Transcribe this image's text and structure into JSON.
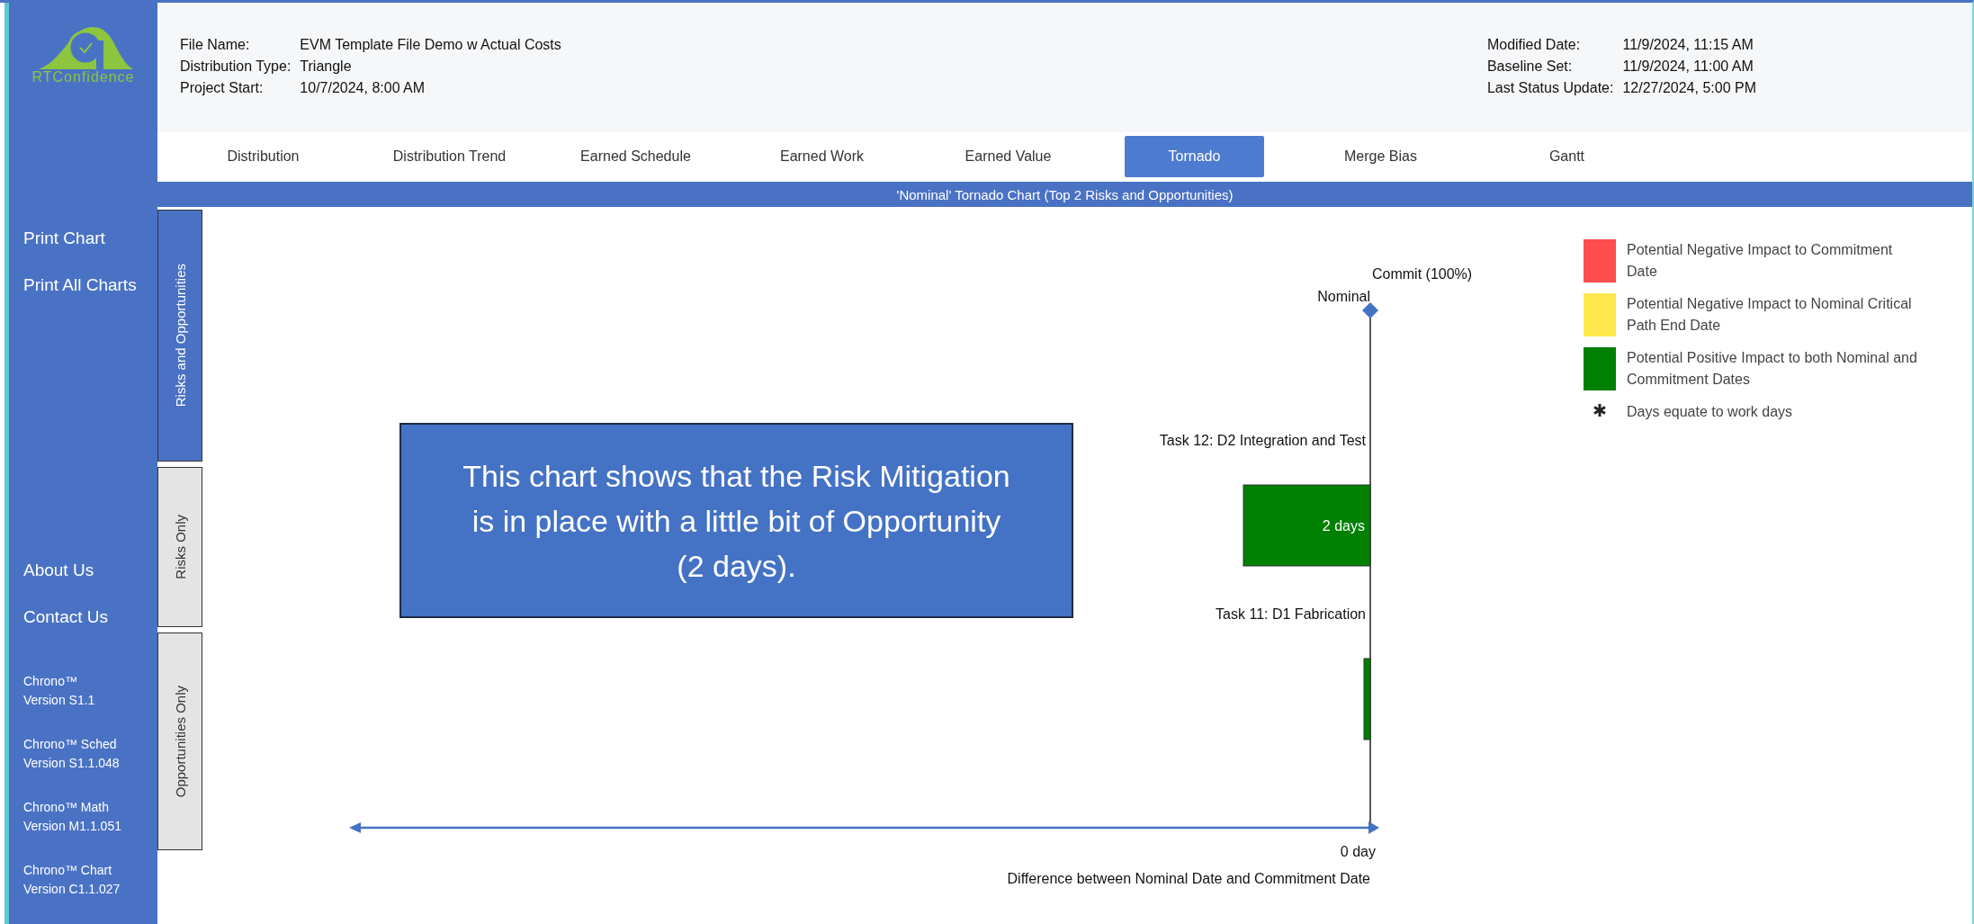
{
  "logo": {
    "text": "RTConfidence"
  },
  "sidebar": {
    "actions": [
      "Print Chart",
      "Print All Charts"
    ],
    "links": [
      "About Us",
      "Contact Us"
    ],
    "versions": [
      {
        "name": "Chrono™",
        "version": "Version S1.1"
      },
      {
        "name": "Chrono™ Sched",
        "version": "Version S1.1.048"
      },
      {
        "name": "Chrono™ Math",
        "version": "Version M1.1.051"
      },
      {
        "name": "Chrono™ Chart",
        "version": "Version C1.1.027"
      }
    ]
  },
  "header": {
    "left": [
      {
        "label": "File Name:",
        "value": "EVM Template File Demo w Actual Costs"
      },
      {
        "label": "Distribution Type:",
        "value": "Triangle"
      },
      {
        "label": "Project Start:",
        "value": "10/7/2024, 8:00 AM"
      }
    ],
    "right": [
      {
        "label": "Modified Date:",
        "value": "11/9/2024, 11:15 AM"
      },
      {
        "label": "Baseline Set:",
        "value": "11/9/2024, 11:00 AM"
      },
      {
        "label": "Last Status Update:",
        "value": "12/27/2024, 5:00 PM"
      }
    ]
  },
  "tabs": [
    {
      "label": "Distribution",
      "selected": false
    },
    {
      "label": "Distribution Trend",
      "selected": false
    },
    {
      "label": "Earned Schedule",
      "selected": false
    },
    {
      "label": "Earned Work",
      "selected": false
    },
    {
      "label": "Earned Value",
      "selected": false
    },
    {
      "label": "Tornado",
      "selected": true
    },
    {
      "label": "Merge Bias",
      "selected": false
    },
    {
      "label": "Gantt",
      "selected": false
    }
  ],
  "chart_title": "'Nominal' Tornado Chart (Top 2 Risks and Opportunities)",
  "view_tabs": [
    {
      "label": "Risks and Opportunities",
      "selected": true
    },
    {
      "label": "Risks Only",
      "selected": false
    },
    {
      "label": "Opportunities Only",
      "selected": false
    }
  ],
  "chart": {
    "commit_label": "Commit (100%)",
    "nominal_label": "Nominal",
    "bars": [
      {
        "task": "Task 12: D2 Integration and Test",
        "value_label": "2 days"
      },
      {
        "task": "Task 11: D1 Fabrication"
      }
    ],
    "zero_label": "0 day",
    "xlabel": "Difference between Nominal Date and Commitment Date"
  },
  "callout": {
    "text": "This chart shows that the Risk Mitigation is in place with a little bit of Opportunity (2 days)."
  },
  "legend": [
    {
      "kind": "swatch",
      "color": "#ff4d4d",
      "label": "Potential Negative Impact to Commitment Date"
    },
    {
      "kind": "swatch",
      "color": "#ffe84d",
      "label": "Potential Negative Impact to Nominal Critical Path End Date"
    },
    {
      "kind": "swatch",
      "color": "#008000",
      "label": "Potential Positive Impact to both Nominal and Commitment Dates"
    },
    {
      "kind": "note",
      "label": "Days equate to work days"
    }
  ]
}
